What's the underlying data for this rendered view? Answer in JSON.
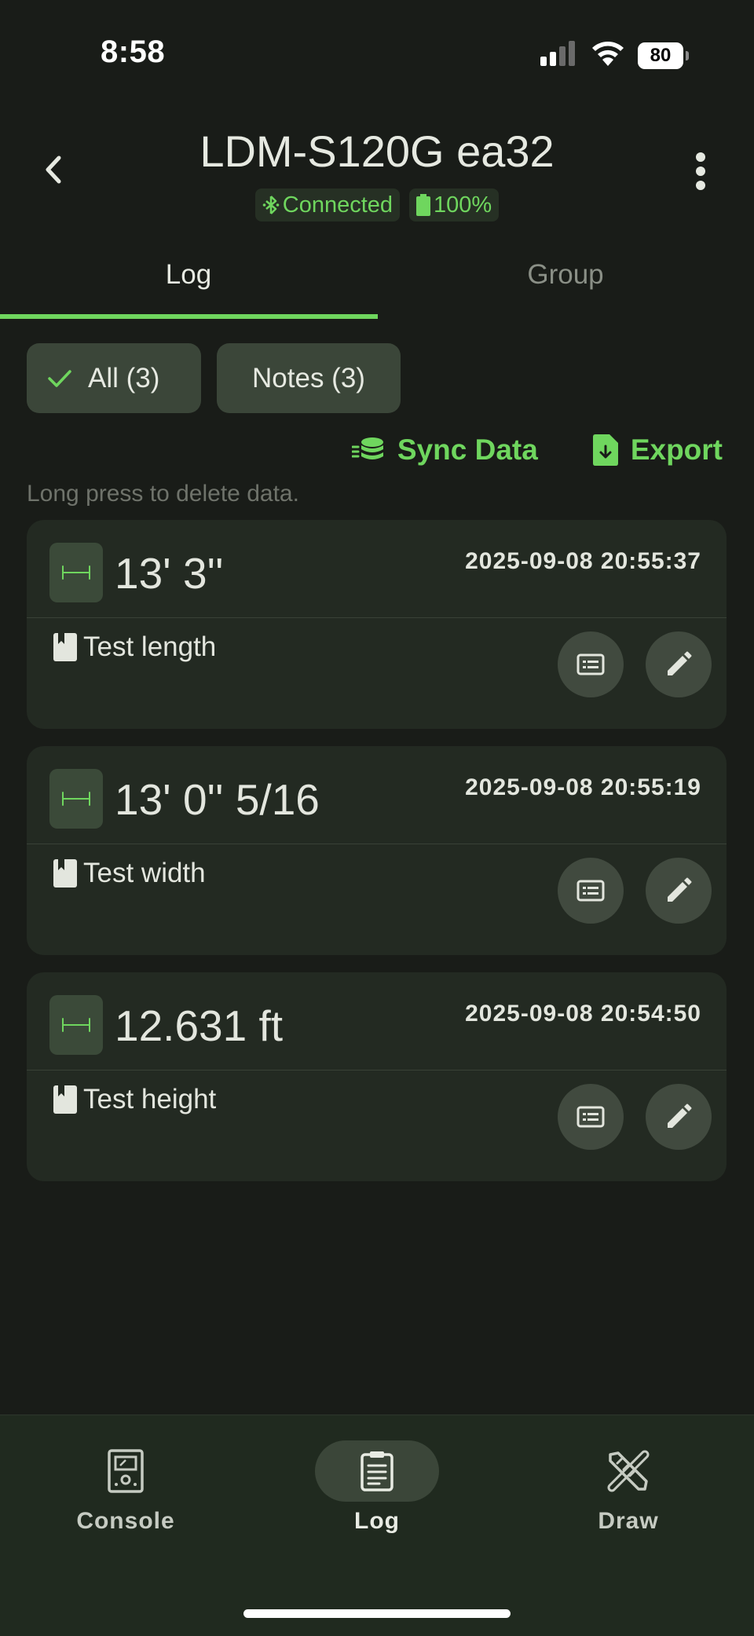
{
  "status_bar": {
    "time": "8:58",
    "battery_level": "80"
  },
  "header": {
    "title": "LDM-S120G ea32",
    "connection_status": "Connected",
    "device_battery": "100%"
  },
  "tabs": [
    {
      "label": "Log",
      "active": true
    },
    {
      "label": "Group",
      "active": false
    }
  ],
  "filters": {
    "all_label": "All (3)",
    "notes_label": "Notes (3)",
    "selected": "all"
  },
  "actions": {
    "sync_label": "Sync Data",
    "export_label": "Export"
  },
  "hint": "Long press to delete data.",
  "records": [
    {
      "value": "13' 3''",
      "timestamp": "2025-09-08 20:55:37",
      "note": "Test length"
    },
    {
      "value": "13' 0'' 5/16",
      "timestamp": "2025-09-08 20:55:19",
      "note": "Test width"
    },
    {
      "value": "12.631 ft",
      "timestamp": "2025-09-08 20:54:50",
      "note": "Test height"
    }
  ],
  "bottom_nav": [
    {
      "label": "Console",
      "icon": "console-icon",
      "active": false
    },
    {
      "label": "Log",
      "icon": "clipboard-icon",
      "active": true
    },
    {
      "label": "Draw",
      "icon": "pencil-ruler-icon",
      "active": false
    }
  ],
  "colors": {
    "accent": "#6fd65e",
    "background": "#191c18",
    "card": "#232a22",
    "chip": "#3b4639"
  }
}
